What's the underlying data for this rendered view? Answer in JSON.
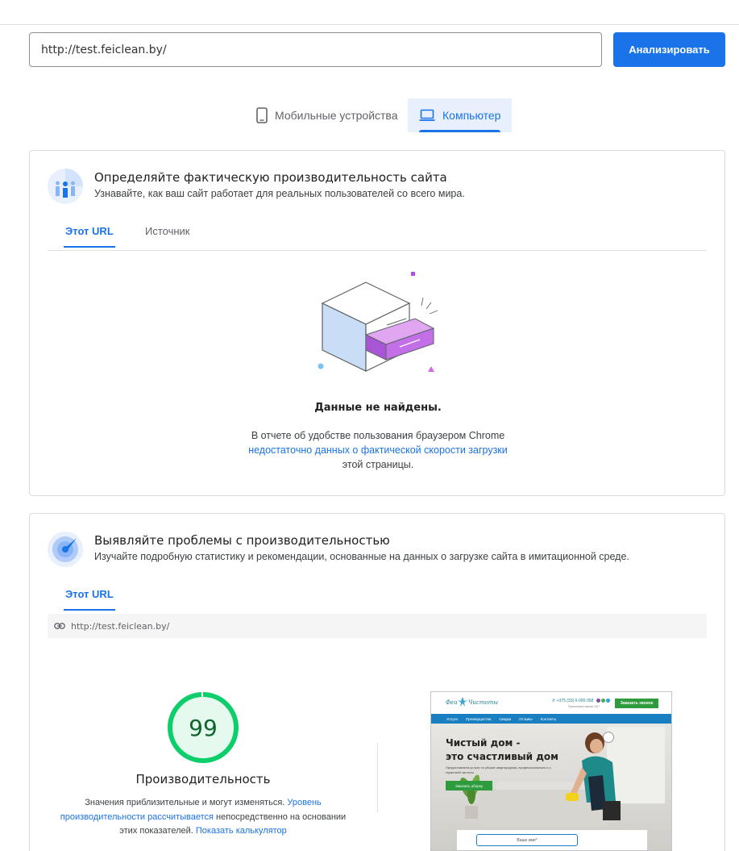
{
  "search": {
    "url_value": "http://test.feiclean.by/",
    "analyze_label": "Анализировать"
  },
  "device_tabs": {
    "mobile_label": "Мобильные устройства",
    "desktop_label": "Компьютер",
    "selected": "desktop"
  },
  "field_section": {
    "title": "Определяйте фактическую производительность сайта",
    "subtitle": "Узнавайте, как ваш сайт работает для реальных пользователей со всего мира.",
    "tabs": [
      "Этот URL",
      "Источник"
    ],
    "active_tab": "Этот URL",
    "no_data_title": "Данные не найдены.",
    "no_data_text_before": "В отчете об удобстве пользования браузером Chrome ",
    "no_data_link": "недостаточно данных о фактической скорости загрузки",
    "no_data_text_after": " этой страницы."
  },
  "lab_section": {
    "title": "Выявляйте проблемы с производительностью",
    "subtitle": "Изучайте подробную статистику и рекомендации, основанные на данных о загрузке сайта в имитационной среде.",
    "tab": "Этот URL",
    "url": "http://test.feiclean.by/",
    "score": "99",
    "score_fraction": 0.99,
    "score_label": "Производительность",
    "note_before": "Значения приблизительные и могут изменяться. ",
    "note_link1": "Уровень производительности рассчитывается",
    "note_middle": " непосредственно на основании этих показателей. ",
    "note_link2": "Показать калькулятор"
  },
  "preview": {
    "logo_left": "Феи",
    "logo_right": "Чистоты",
    "phone": "+375 (33) 6-000-358",
    "phone_sub": "Принимаем заказы 24/7",
    "order_button": "Заказать звонок",
    "nav": [
      "Услуги",
      "Преимущества",
      "Скидки",
      "Отзывы",
      "Контакты"
    ],
    "headline_1": "Чистый дом -",
    "headline_2": "это счастливый дом",
    "paragraph": "Предоставляем услуги по уборке квартир/дома, профессионально и с гарантией чистоты",
    "cta": "Заказать уборку",
    "input_placeholder": "Ваше имя*"
  },
  "colors": {
    "accent": "#1a73e8",
    "good": "#0cce6b",
    "good_text": "#0d652d"
  }
}
